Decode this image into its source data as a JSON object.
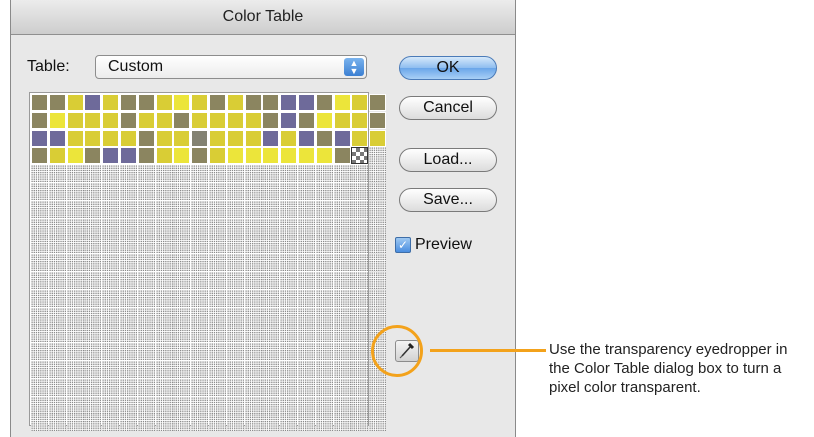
{
  "dialog": {
    "title": "Color Table",
    "table_label": "Table:",
    "table_select_value": "Custom",
    "buttons": {
      "ok": "OK",
      "cancel": "Cancel",
      "load": "Load...",
      "save": "Save..."
    },
    "preview_label": "Preview",
    "preview_checked": true
  },
  "swatches": {
    "columns": 20,
    "rows": 19,
    "colors": {
      "O": "#8b8560",
      "Y": "#d9cd35",
      "B": "#ece53a",
      "P": "#6e6a9a",
      "G": "#838272",
      "T": "transparent"
    },
    "filled_rows": [
      "OOYPYOOYBYOYOOPPOBYO",
      "OBYYYOYYOYYYYOPOBYYO",
      "PPYYYYOYYGYYYPYPOPYY",
      "OYBOPPOYBOYBBBBBBOT"
    ]
  },
  "annotation": {
    "text": "Use the transparency eyedropper in the Color Table dialog box to turn a pixel color transparent.",
    "highlight_color": "#f3a21b"
  }
}
